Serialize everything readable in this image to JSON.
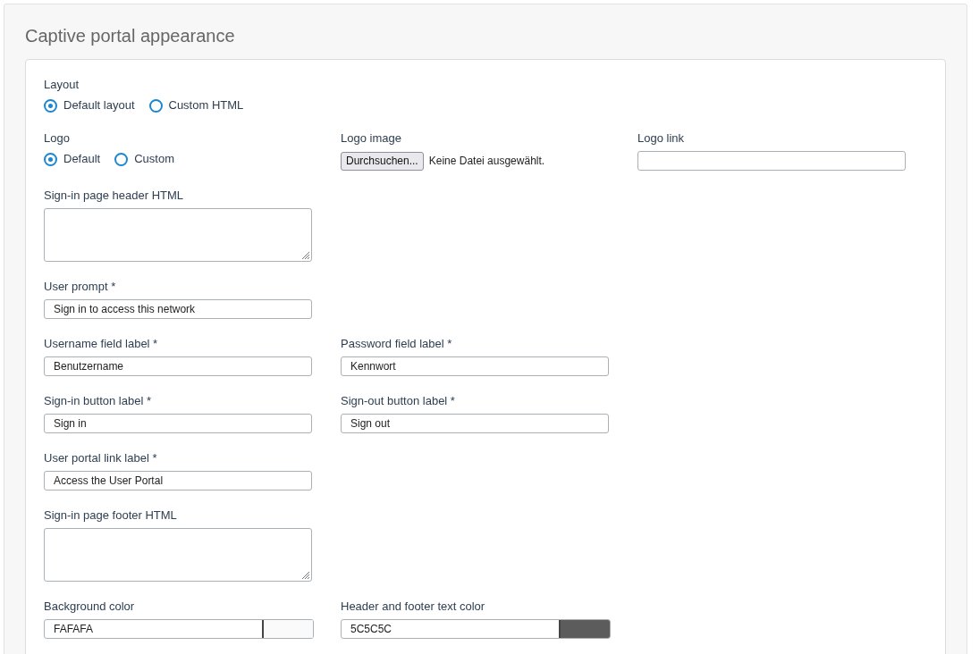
{
  "title": "Captive portal appearance",
  "rows": [
    {
      "fields": [
        {
          "kind": "radio",
          "label": "Layout",
          "options": [
            {
              "label": "Default layout",
              "selected": true
            },
            {
              "label": "Custom HTML",
              "selected": false
            }
          ]
        }
      ]
    },
    {
      "fields": [
        {
          "kind": "radio",
          "label": "Logo",
          "options": [
            {
              "label": "Default",
              "selected": true
            },
            {
              "label": "Custom",
              "selected": false
            }
          ]
        },
        {
          "kind": "file",
          "label": "Logo image",
          "button": "Durchsuchen...",
          "status": "Keine Datei ausgewählt."
        },
        {
          "kind": "text",
          "label": "Logo link"
        }
      ]
    },
    {
      "fields": [
        {
          "kind": "textarea",
          "label": "Sign-in page header HTML"
        }
      ]
    },
    {
      "fields": [
        {
          "kind": "text",
          "label": "User prompt *",
          "value": "Sign in to access this network"
        }
      ]
    },
    {
      "fields": [
        {
          "kind": "text",
          "label": "Username field label *",
          "value": "Benutzername"
        },
        {
          "kind": "text",
          "label": "Password field label *",
          "value": "Kennwort"
        }
      ]
    },
    {
      "fields": [
        {
          "kind": "text",
          "label": "Sign-in button label *",
          "value": "Sign in"
        },
        {
          "kind": "text",
          "label": "Sign-out button label *",
          "value": "Sign out"
        }
      ]
    },
    {
      "fields": [
        {
          "kind": "text",
          "label": "User portal link label *",
          "value": "Access the User Portal"
        }
      ]
    },
    {
      "fields": [
        {
          "kind": "textarea",
          "label": "Sign-in page footer HTML"
        }
      ]
    },
    {
      "fields": [
        {
          "kind": "color",
          "label": "Background color",
          "value": "FAFAFA",
          "color": "#fafafa"
        },
        {
          "kind": "color",
          "label": "Header and footer text color",
          "value": "5C5C5C",
          "color": "#5c5c5c"
        }
      ]
    }
  ]
}
